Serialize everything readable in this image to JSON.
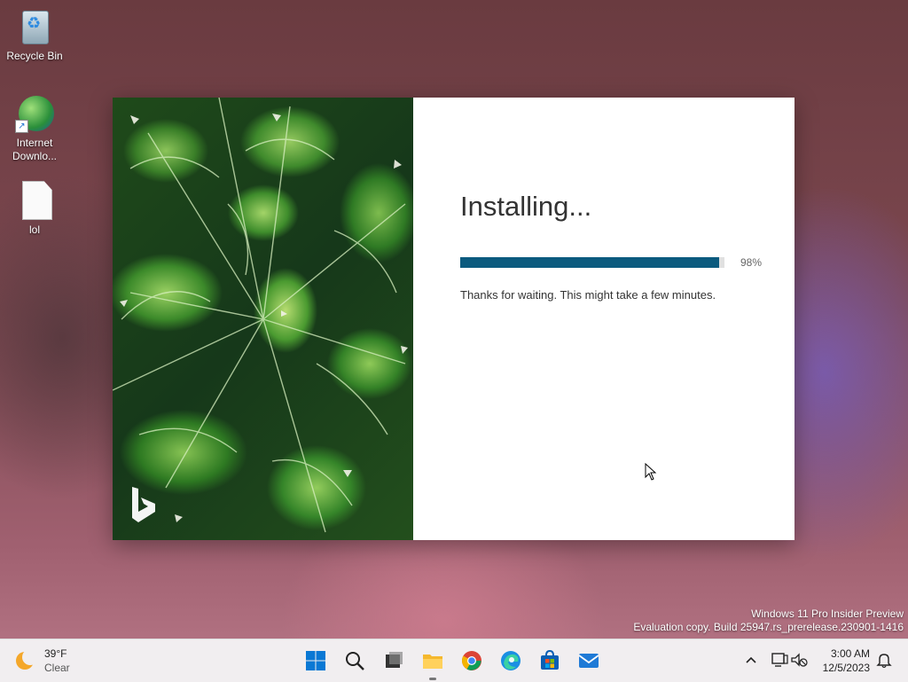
{
  "desktop": {
    "icons": [
      {
        "label": "Recycle Bin"
      },
      {
        "label": "Internet Downlo..."
      },
      {
        "label": "lol"
      }
    ]
  },
  "installer": {
    "title": "Installing...",
    "progress_fraction": 0.98,
    "percent_label": "98%",
    "message": "Thanks for waiting. This might take a few minutes.",
    "accent_color": "#0b5a7e"
  },
  "watermark": {
    "line1": "Windows 11 Pro Insider Preview",
    "line2": "Evaluation copy. Build 25947.rs_prerelease.230901-1416"
  },
  "taskbar": {
    "weather": {
      "temp": "39°F",
      "condition": "Clear"
    },
    "apps": [
      "start-icon",
      "search-icon",
      "task-view-icon",
      "file-explorer-icon",
      "chrome-icon",
      "edge-icon",
      "microsoft-store-icon",
      "mail-icon"
    ],
    "clock": {
      "time": "3:00 AM",
      "date": "12/5/2023"
    }
  }
}
